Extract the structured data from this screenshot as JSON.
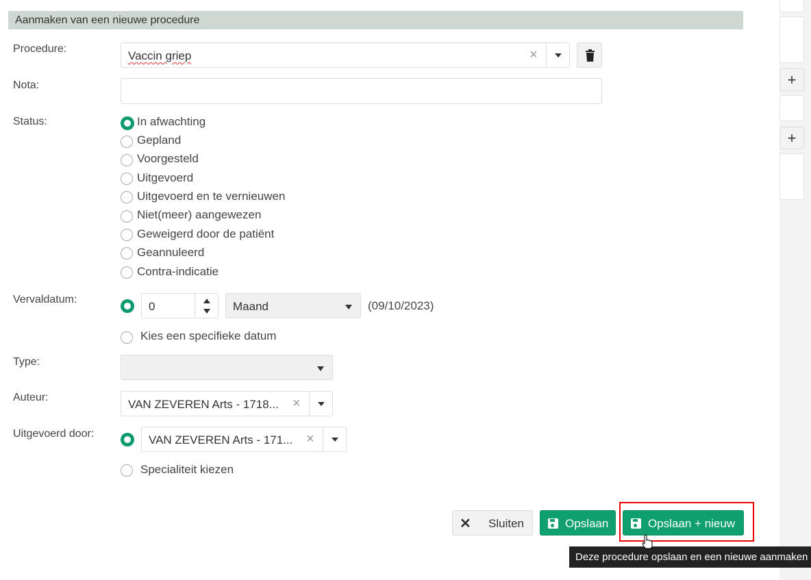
{
  "header": {
    "title": "Aanmaken van een nieuwe procedure"
  },
  "procedure": {
    "label": "Procedure:",
    "value": "Vaccin griep",
    "clear_icon": "×"
  },
  "nota": {
    "label": "Nota:",
    "value": ""
  },
  "status": {
    "label": "Status:",
    "options": [
      "In afwachting",
      "Gepland",
      "Voorgesteld",
      "Uitgevoerd",
      "Uitgevoerd en te vernieuwen",
      "Niet(meer) aangewezen",
      "Geweigerd door de patiënt",
      "Geannuleerd",
      "Contra-indicatie"
    ],
    "selected": "In afwachting"
  },
  "vervaldatum": {
    "label": "Vervaldatum:",
    "amount": "0",
    "unit": "Maand",
    "computed_date": "(09/10/2023)",
    "specific_date_label": "Kies een specifieke datum"
  },
  "type": {
    "label": "Type:",
    "value": ""
  },
  "auteur": {
    "label": "Auteur:",
    "value": "VAN ZEVEREN Arts - 1718...",
    "clear_icon": "×"
  },
  "uitgevoerd_door": {
    "label": "Uitgevoerd door:",
    "value": "VAN ZEVEREN Arts - 171...",
    "clear_icon": "×",
    "specialty_label": "Specialiteit kiezen"
  },
  "buttons": {
    "close_icon": "✕",
    "close": "Sluiten",
    "save": "Opslaan",
    "save_new": "Opslaan + nieuw"
  },
  "tooltip": {
    "text": "Deze procedure opslaan en een nieuwe aanmaken"
  },
  "right_panel": {
    "plus": "+"
  },
  "colors": {
    "accent": "#10a070",
    "header_bg": "#cdd8d2",
    "highlight": "#e00000"
  }
}
